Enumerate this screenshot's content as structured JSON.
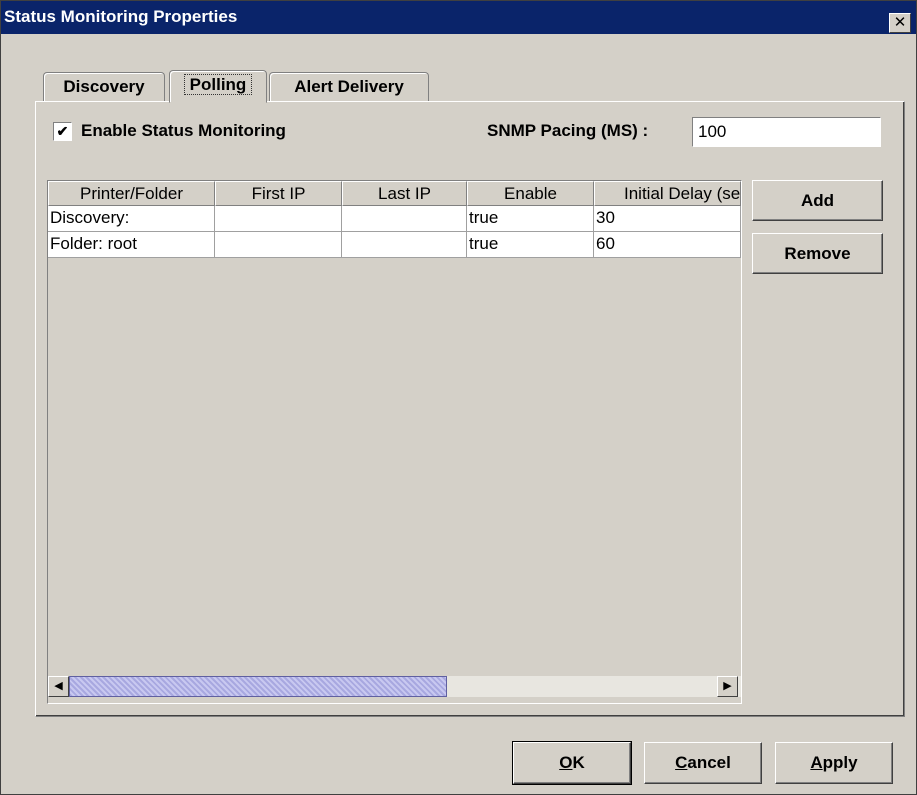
{
  "window": {
    "title": "Status Monitoring Properties",
    "close_glyph": "✕"
  },
  "tabs": [
    {
      "label": "Discovery",
      "active": false
    },
    {
      "label": "Polling",
      "active": true
    },
    {
      "label": "Alert Delivery",
      "active": false
    }
  ],
  "polling": {
    "enable_label": "Enable Status Monitoring",
    "enable_checked": true,
    "check_glyph": "✔",
    "pacing_label": "SNMP Pacing (MS) :",
    "pacing_value": "100"
  },
  "table": {
    "columns": [
      "Printer/Folder",
      "First IP",
      "Last IP",
      "Enable",
      "Initial Delay (sec)"
    ],
    "rows": [
      [
        "Discovery:",
        "",
        "",
        "true",
        "30"
      ],
      [
        "Folder: root",
        "",
        "",
        "true",
        "60"
      ]
    ],
    "scroll_left_glyph": "◀",
    "scroll_right_glyph": "▶"
  },
  "side_buttons": {
    "add": "Add",
    "remove": "Remove"
  },
  "dialog_buttons": {
    "ok": "OK",
    "cancel": "Cancel",
    "apply": "Apply"
  },
  "colors": {
    "titlebar": "#0a246a",
    "face": "#d4d0c8",
    "scroll_thumb": "#b0b0e8"
  }
}
